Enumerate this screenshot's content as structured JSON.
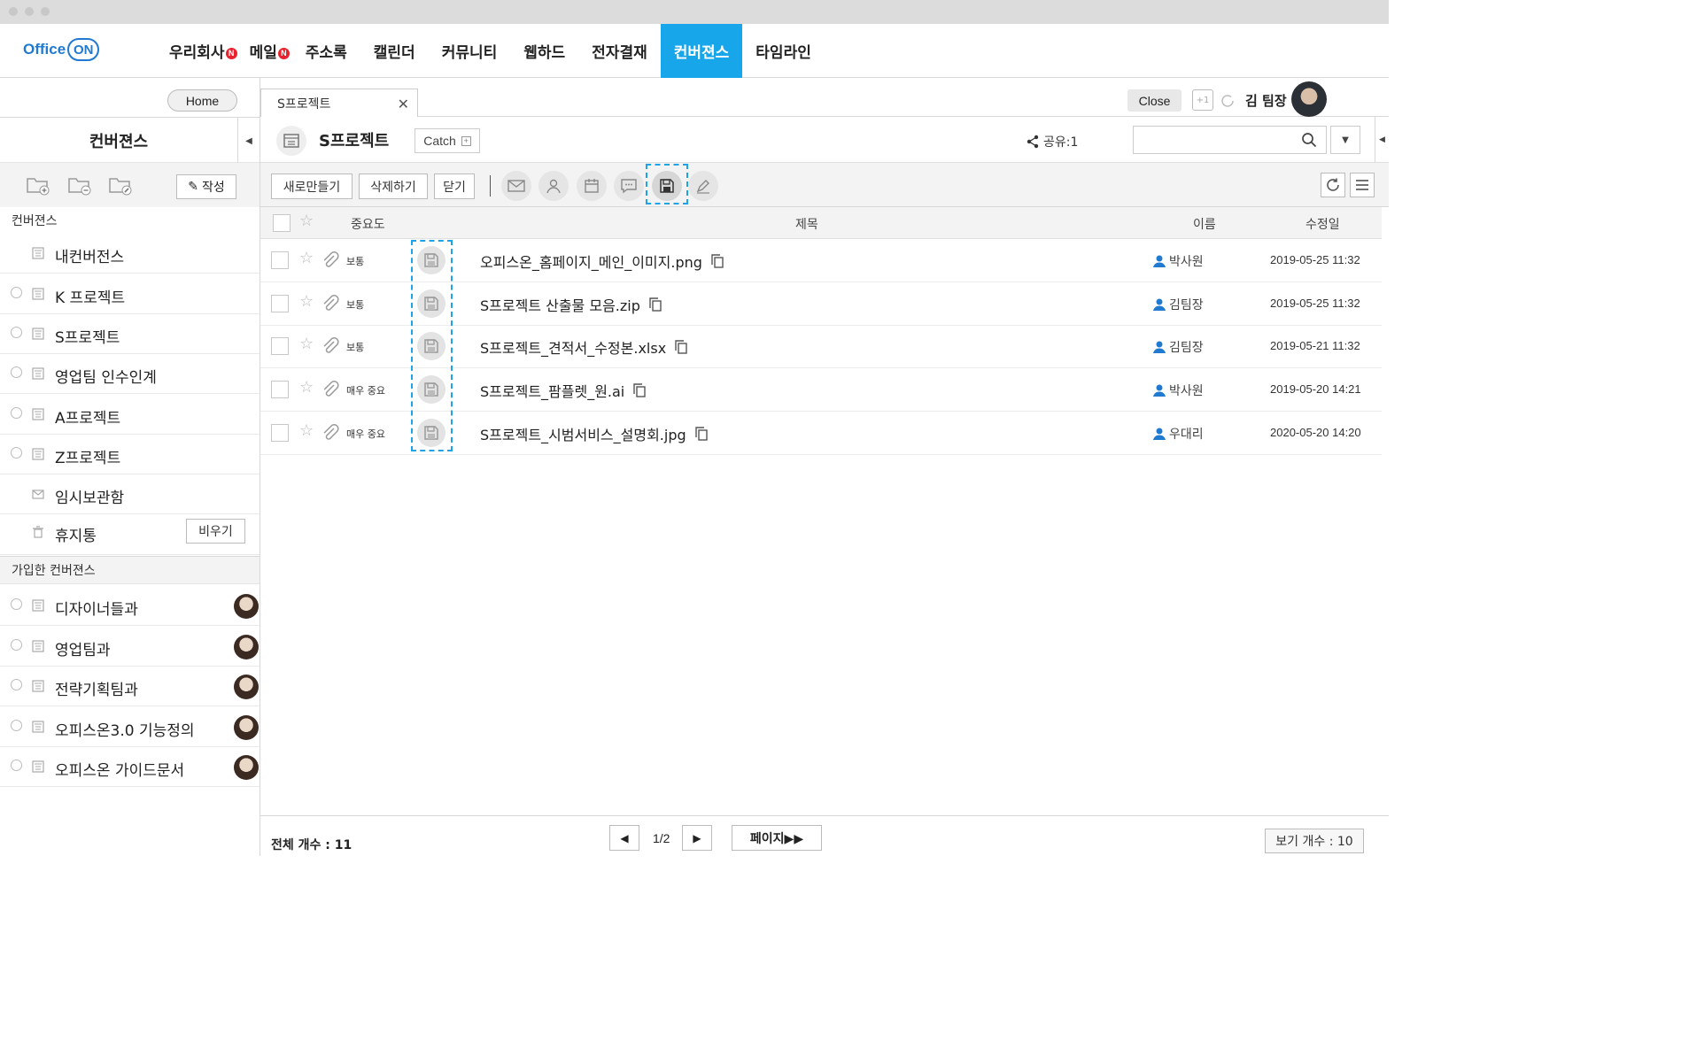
{
  "app": {
    "logo_text": "Office",
    "logo_on": "ON"
  },
  "gnb": {
    "items": [
      {
        "label": "우리회사",
        "badge": "N"
      },
      {
        "label": "메일",
        "badge": "N"
      },
      {
        "label": "주소록"
      },
      {
        "label": "캘린더"
      },
      {
        "label": "커뮤니티"
      },
      {
        "label": "웹하드"
      },
      {
        "label": "전자결재"
      },
      {
        "label": "컨버젼스",
        "active": true
      },
      {
        "label": "타임라인"
      }
    ],
    "accent_color": "#17a6ea"
  },
  "sidebar": {
    "home_label": "Home",
    "title": "컨버젼스",
    "write_label": "작성",
    "section_convergence": "컨버젼스",
    "items": [
      {
        "label": "내컨버전스",
        "radio": false,
        "icon": "document-icon"
      },
      {
        "label": "K 프로젝트",
        "radio": true,
        "icon": "document-icon"
      },
      {
        "label": "S프로젝트",
        "radio": true,
        "icon": "document-icon"
      },
      {
        "label": "영업팀 인수인계",
        "radio": true,
        "icon": "document-icon"
      },
      {
        "label": "A프로젝트",
        "radio": true,
        "icon": "document-icon"
      },
      {
        "label": "Z프로젝트",
        "radio": true,
        "icon": "document-icon"
      },
      {
        "label": "임시보관함",
        "radio": false,
        "icon": "envelope-icon"
      },
      {
        "label": "휴지통",
        "radio": false,
        "icon": "trash-icon"
      }
    ],
    "empty_label": "비우기",
    "section_joined": "가입한 컨버젼스",
    "joined": [
      {
        "label": "디자이너들과"
      },
      {
        "label": "영업팀과"
      },
      {
        "label": "전략기획팀과"
      },
      {
        "label": "오피스온3.0 기능정의"
      },
      {
        "label": "오피스온 가이드문서"
      }
    ]
  },
  "tabbar": {
    "tab_label": "S프로젝트",
    "close_label": "Close",
    "plus_label": "+1",
    "user_name": "김 팀장"
  },
  "conversation": {
    "title": "S프로젝트",
    "catch_label": "Catch",
    "share_label": "공유:1",
    "search_placeholder": ""
  },
  "toolbar": {
    "new_label": "새로만들기",
    "delete_label": "삭제하기",
    "close_label": "닫기"
  },
  "table": {
    "columns": {
      "importance": "중요도",
      "title": "제목",
      "name": "이름",
      "modified": "수정일"
    },
    "rows": [
      {
        "importance": "보통",
        "file": "오피스온_홈페이지_메인_이미지.png",
        "author": "박사원",
        "date": "2019-05-25 11:32"
      },
      {
        "importance": "보통",
        "file": "S프로젝트 산출물 모음.zip",
        "author": "김팀장",
        "date": "2019-05-25 11:32"
      },
      {
        "importance": "보통",
        "file": "S프로젝트_견적서_수정본.xlsx",
        "author": "김팀장",
        "date": "2019-05-21 11:32"
      },
      {
        "importance": "매우 중요",
        "file": "S프로젝트_팜플렛_원.ai",
        "author": "박사원",
        "date": "2019-05-20 14:21"
      },
      {
        "importance": "매우 중요",
        "file": "S프로젝트_시범서비스_설명회.jpg",
        "author": "우대리",
        "date": "2020-05-20 14:20"
      }
    ]
  },
  "footer": {
    "total_label": "전체 개수 : 11",
    "page_label": "1/2",
    "page_jump_label": "페이지▶▶",
    "view_count_label": "보기 개수 : 10"
  }
}
